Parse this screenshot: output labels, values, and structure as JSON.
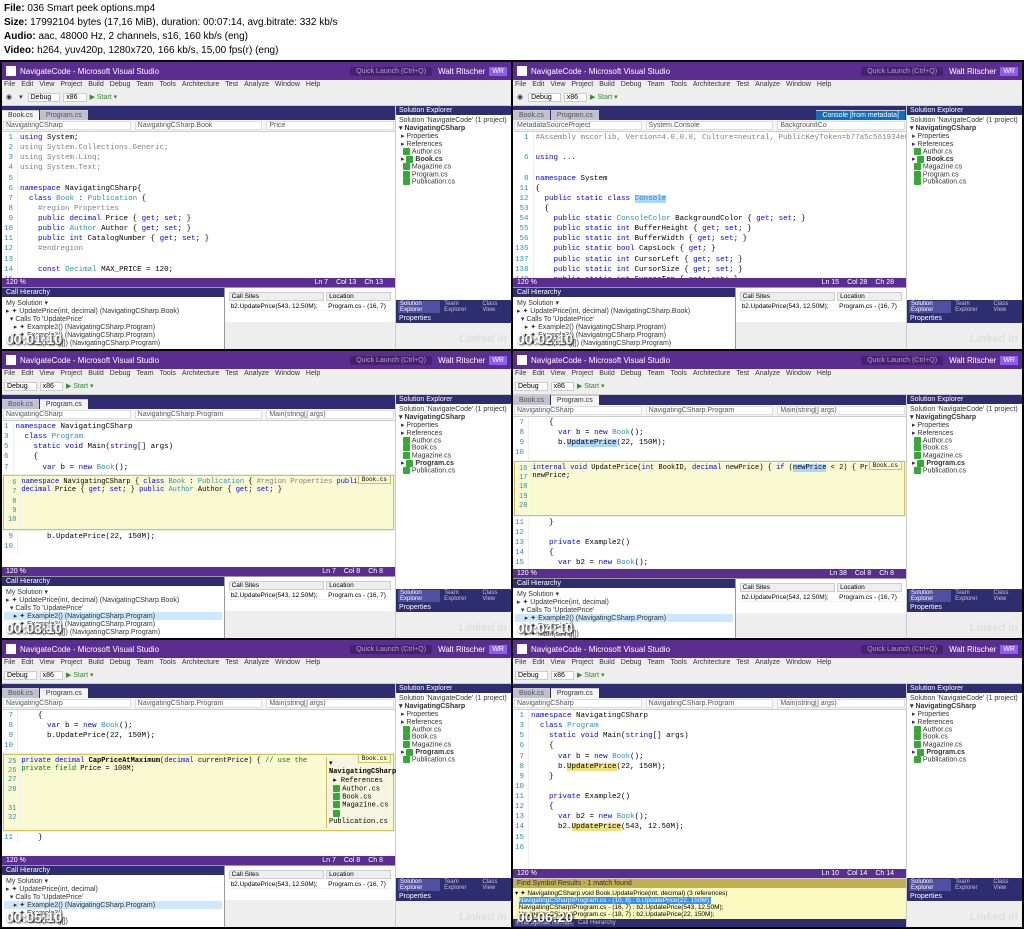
{
  "header": {
    "file_label": "File:",
    "file": "036 Smart peek options.mp4",
    "size_label": "Size:",
    "size": "17992104 bytes (17,16 MiB), duration: 00:07:14, avg.bitrate: 332 kb/s",
    "audio_label": "Audio:",
    "audio": "aac, 48000 Hz, 2 channels, s16, 160 kb/s (eng)",
    "video_label": "Video:",
    "video": "h264, yuv420p, 1280x720, 166 kb/s, 15,00 fps(r) (eng)"
  },
  "common": {
    "app_title": "NavigateCode - Microsoft Visual Studio",
    "quick_launch": "Quick Launch (Ctrl+Q)",
    "user": "Walt Ritscher",
    "badge": "WR",
    "menus": [
      "File",
      "Edit",
      "View",
      "Project",
      "Build",
      "Debug",
      "Team",
      "Tools",
      "Architecture",
      "Test",
      "Analyze",
      "Window",
      "Help"
    ],
    "config": "Debug",
    "platform": "x86",
    "start": "▶ Start ▾",
    "sol_title": "Solution Explorer",
    "sol_root": "Solution 'NavigateCode' (1 project)",
    "proj": "NavigatingCSharp",
    "items": [
      "Properties",
      "References",
      "Author.cs",
      "Book.cs",
      "Magazine.cs",
      "Program.cs",
      "Publication.cs"
    ],
    "props_title": "Properties",
    "callh_title": "Call Hierarchy",
    "my_sol": "My Solution",
    "watermark": "Linked in",
    "team_tab": "Team Explorer",
    "class_tab": "Class View"
  },
  "cells": [
    {
      "ts": "00:01:10",
      "tabs": [
        "Book.cs",
        "Program.cs"
      ],
      "active_tab": 0,
      "nav1": "NavigatingCSharp",
      "nav2": "NavigatingCSharp.Book",
      "nav3": "Price",
      "gutter": "1\n2\n3\n4\n5\n6\n7\n8\n9\n10\n11\n12\n13\n14\n15\n",
      "status": {
        "pct": "120 %",
        "ln": "Ln 7",
        "col": "Col 13",
        "ch": "Ch 13"
      },
      "call_root": "UpdatePrice(int, decimal)  (NavigatingCSharp.Book)",
      "call_sub": "Calls To 'UpdatePrice'",
      "call_items": [
        "Example2()  (NavigatingCSharp.Program)",
        "Example3()  (NavigatingCSharp.Program)",
        "Main(string[])  (NavigatingCSharp.Program)"
      ],
      "sites_hdr": [
        "Call Sites",
        "Location"
      ],
      "sites_row": [
        "b2.UpdatePrice(543, 12.50M);",
        "Program.cs - (16, 7)"
      ],
      "sol_hl": "Book.cs"
    },
    {
      "ts": "00:02:10",
      "tabs": [
        "Book.cs",
        "Program.cs"
      ],
      "active_tab": 0,
      "extra_tab": "Console [from metadata]",
      "nav1": "MetadataSourceProject",
      "nav2": "System.Console",
      "nav3": "BackgroundCo",
      "gutter": "1\n\n6\n\n8\n11\n12\n53\n54\n55\n56\n136\n137\n138\n149\n",
      "status": {
        "pct": "120 %",
        "ln": "Ln 15",
        "col": "Col 28",
        "ch": "Ch 28"
      },
      "call_root": "UpdatePrice(int, decimal)  (NavigatingCSharp.Book)",
      "call_sub": "Calls To 'UpdatePrice'",
      "call_items": [
        "Example2()  (NavigatingCSharp.Program)",
        "Example3()  (NavigatingCSharp.Program)",
        "Main(string[])  (NavigatingCSharp.Program)"
      ],
      "sites_row": [
        "b2.UpdatePrice(543, 12.50M);",
        "Program.cs - (16, 7)"
      ],
      "sol_hl": "Book.cs"
    },
    {
      "ts": "00:03:10",
      "tabs": [
        "Book.cs",
        "Program.cs"
      ],
      "active_tab": 1,
      "nav1": "NavigatingCSharp",
      "nav2": "NavigatingCSharp.Program",
      "nav3": "Main(string[] args)",
      "gutter": "1\n3\n5\n6\n7\n",
      "peek_tab": "Book.cs",
      "peek_gutter": "6\n7\n8\n9\n10",
      "after_gutter": "9\n10\n",
      "after_line": "b.UpdatePrice(22, 150M);",
      "status": {
        "pct": "120 %",
        "ln": "Ln 7",
        "col": "Col 8",
        "ch": "Ch 8"
      },
      "call_hl": "Example2()  (NavigatingCSharp.Program)",
      "sites_row": [
        "b2.UpdatePrice(543, 12.50M);",
        "Program.cs - (16, 7)"
      ],
      "sol_hl": "Program.cs"
    },
    {
      "ts": "00:04:10",
      "tabs": [
        "Book.cs",
        "Program.cs"
      ],
      "active_tab": 1,
      "nav1": "NavigatingCSharp",
      "nav2": "NavigatingCSharp.Program",
      "nav3": "Main(string[] args)",
      "gutter": "7\n8\n9\n10\n",
      "peek_tab": "Book.cs",
      "peek_gutter": "16\n17\n18\n19\n20",
      "after_gutter": "11\n12\n13\n14\n15\n",
      "status": {
        "pct": "120 %",
        "ln": "Ln 38",
        "col": "Col 8",
        "ch": "Ch 8"
      },
      "call_hl": "Example2()  (NavigatingCSharp.Program)",
      "sites_row": [
        "b2.UpdatePrice(543, 12.50M);",
        "Program.cs - (16, 7)"
      ],
      "sol_hl": "Program.cs"
    },
    {
      "ts": "00:05:10",
      "tabs": [
        "Book.cs",
        "Program.cs"
      ],
      "active_tab": 1,
      "nav1": "NavigatingCSharp",
      "nav2": "NavigatingCSharp.Program",
      "nav3": "Main(string[] args)",
      "gutter": "7\n8\n9\n10\n",
      "peek_tab": "Book.cs",
      "peek_gutter": "25\n26\n27\n28\n \n31\n32",
      "after_gutter": "11\n",
      "status": {
        "pct": "120 %",
        "ln": "Ln 7",
        "col": "Col 8",
        "ch": "Ch 8"
      },
      "call_hl": "Example2()  (NavigatingCSharp.Program)",
      "sites_row": [
        "b2.UpdatePrice(543, 12.50M);",
        "Program.cs - (16, 7)"
      ],
      "sol_hl": "Program.cs"
    },
    {
      "ts": "00:06:20",
      "tabs": [
        "Book.cs",
        "Program.cs"
      ],
      "active_tab": 1,
      "nav1": "NavigatingCSharp",
      "nav2": "NavigatingCSharp.Program",
      "nav3": "Main(string[] args)",
      "gutter": "1\n3\n5\n6\n7\n8\n9\n10\n11\n12\n13\n14\n15\n16",
      "status": {
        "pct": "120 %",
        "ln": "Ln 10",
        "col": "Col 14",
        "ch": "Ch 14"
      },
      "find_title": "Find Symbol Results - 1 match found",
      "find_root": "NavigatingCSharp.void Book.UpdatePrice(int, decimal) (3 references)",
      "find_items": [
        "NavigatingCSharp\\Program.cs - (10, 8) : b.UpdatePrice(22, 150M);",
        "NavigatingCSharp\\Program.cs - (16, 7) : b2.UpdatePrice(543, 12.50M);",
        "NavigatingCSharp\\Program.cs - (18, 7) : b2.UpdatePrice(22, 150M);"
      ],
      "find_tabs": [
        "Find Symbol Results",
        "Call Hierarchy"
      ],
      "sol_hl": "Program.cs"
    }
  ]
}
